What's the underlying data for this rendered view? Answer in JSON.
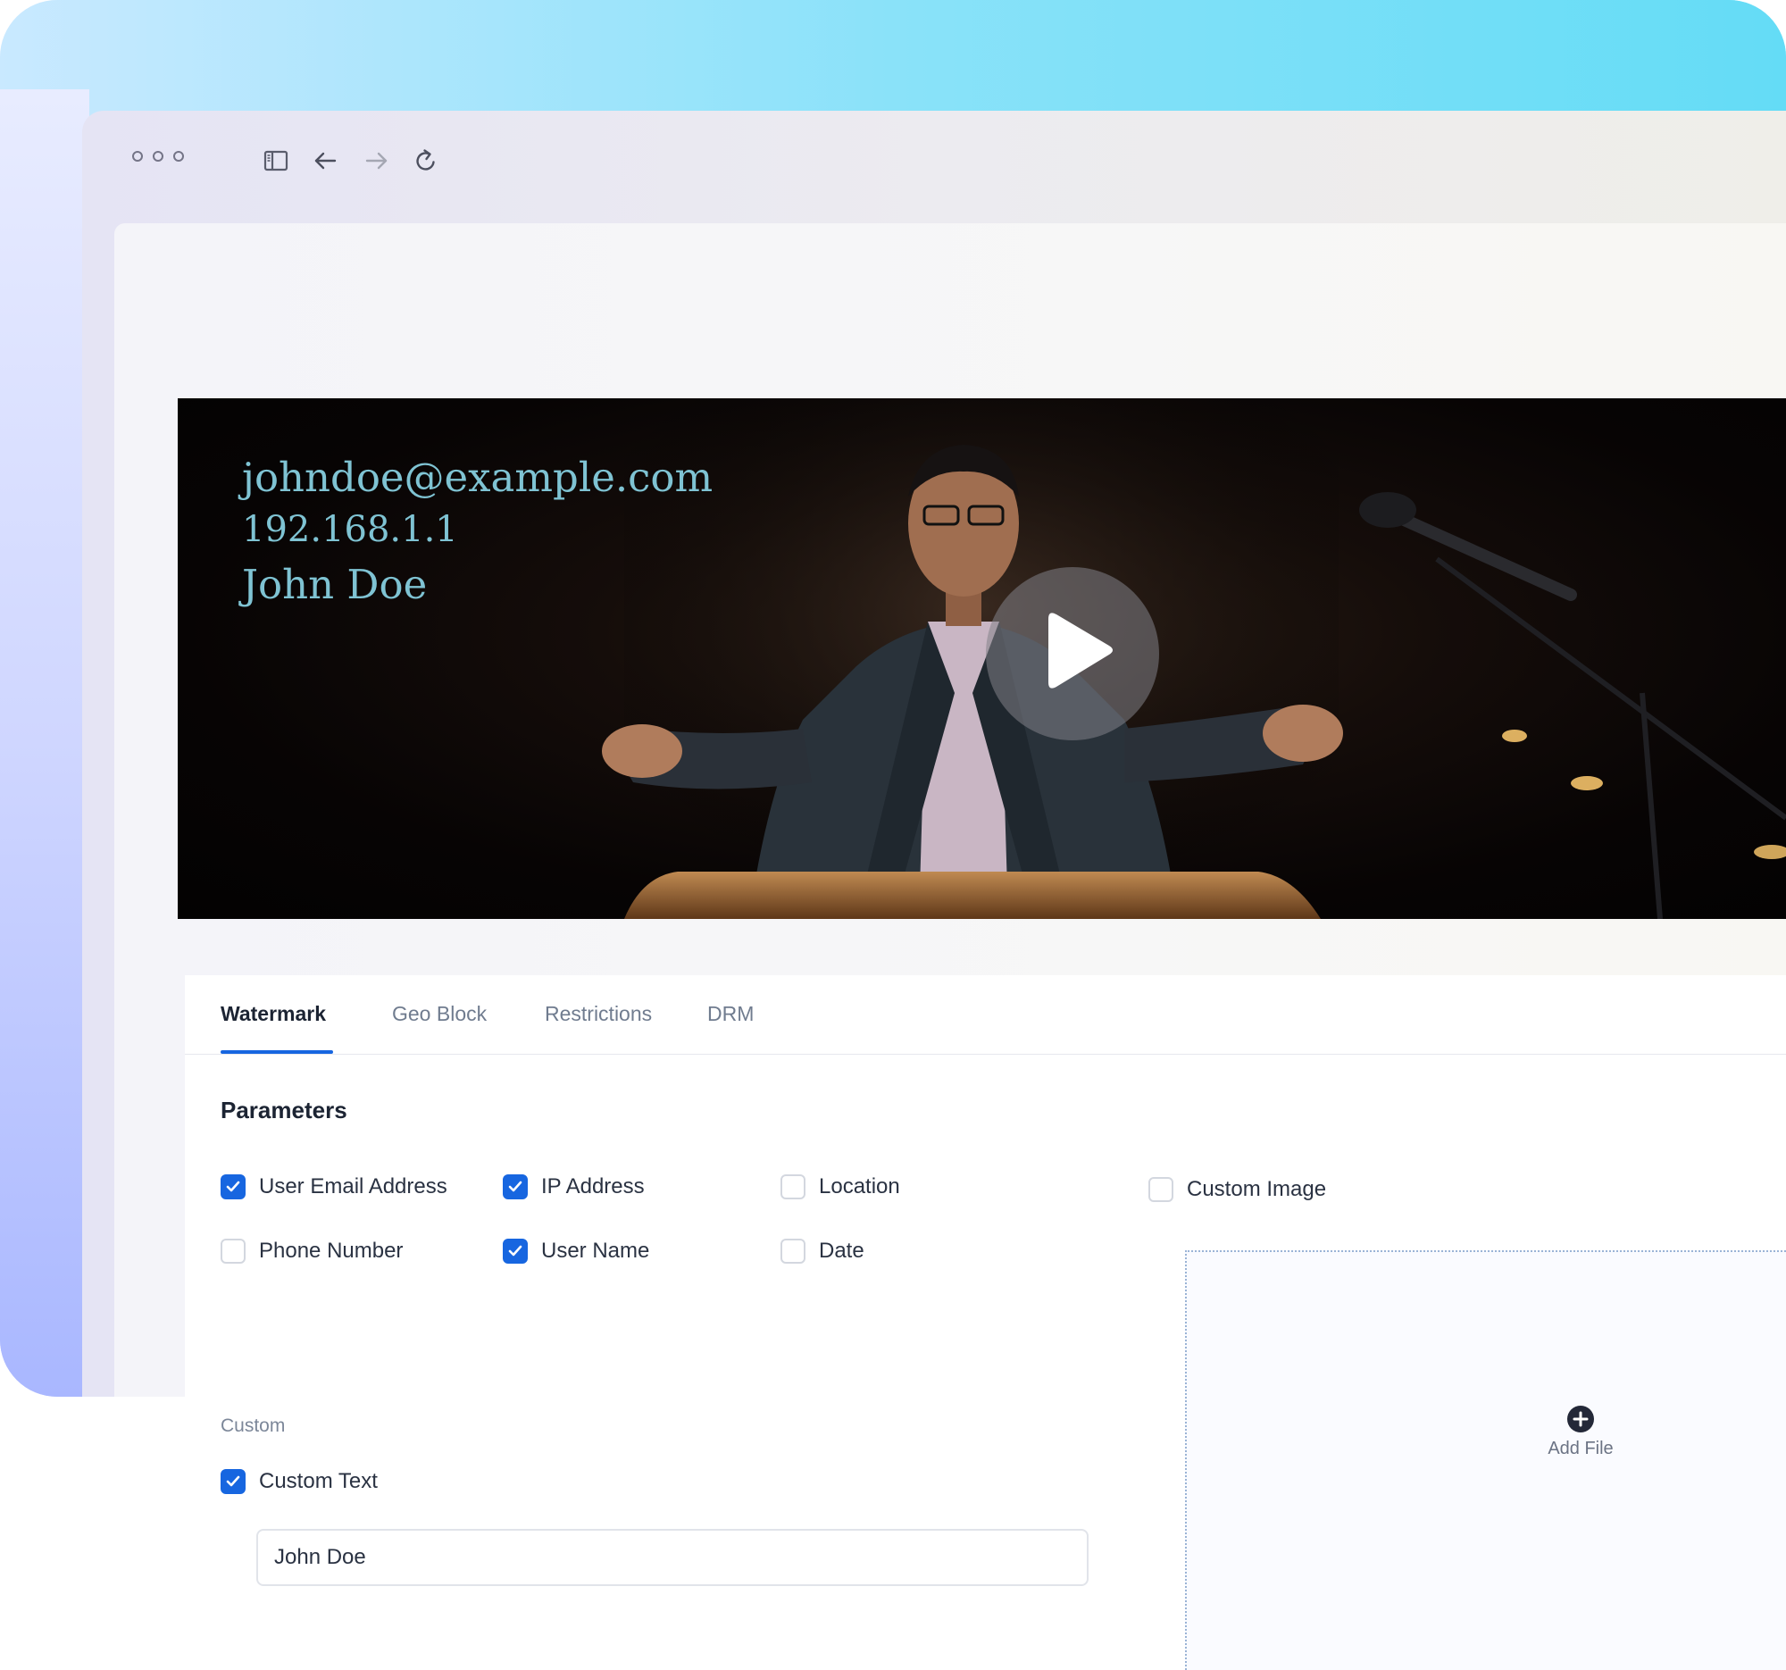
{
  "browser": {
    "toolbar_icons": [
      "sidebar-toggle-icon",
      "back-arrow-icon",
      "forward-arrow-icon",
      "reload-icon"
    ]
  },
  "video": {
    "watermark_lines": {
      "email": "johndoe@example.com",
      "ip": "192.168.1.1",
      "name": "John Doe"
    },
    "play_icon": "play-icon",
    "watermark_color": "#7fc3d3"
  },
  "tabs": [
    {
      "label": "Watermark",
      "active": true
    },
    {
      "label": "Geo Block",
      "active": false
    },
    {
      "label": "Restrictions",
      "active": false
    },
    {
      "label": "DRM",
      "active": false
    }
  ],
  "parameters": {
    "title": "Parameters",
    "options": [
      {
        "label": "User Email Address",
        "checked": true
      },
      {
        "label": "IP Address",
        "checked": true
      },
      {
        "label": "Location",
        "checked": false
      },
      {
        "label": "Phone Number",
        "checked": false
      },
      {
        "label": "User Name",
        "checked": true
      },
      {
        "label": "Date",
        "checked": false
      }
    ],
    "custom_section_label": "Custom",
    "custom_text": {
      "label": "Custom Text",
      "checked": true,
      "value": "John Doe"
    }
  },
  "custom_image": {
    "label": "Custom Image",
    "checked": false,
    "add_file_label": "Add File",
    "add_icon": "plus-circle-icon"
  },
  "colors": {
    "accent": "#1766e0",
    "text_primary": "#1c2433",
    "text_muted": "#707c8f"
  }
}
